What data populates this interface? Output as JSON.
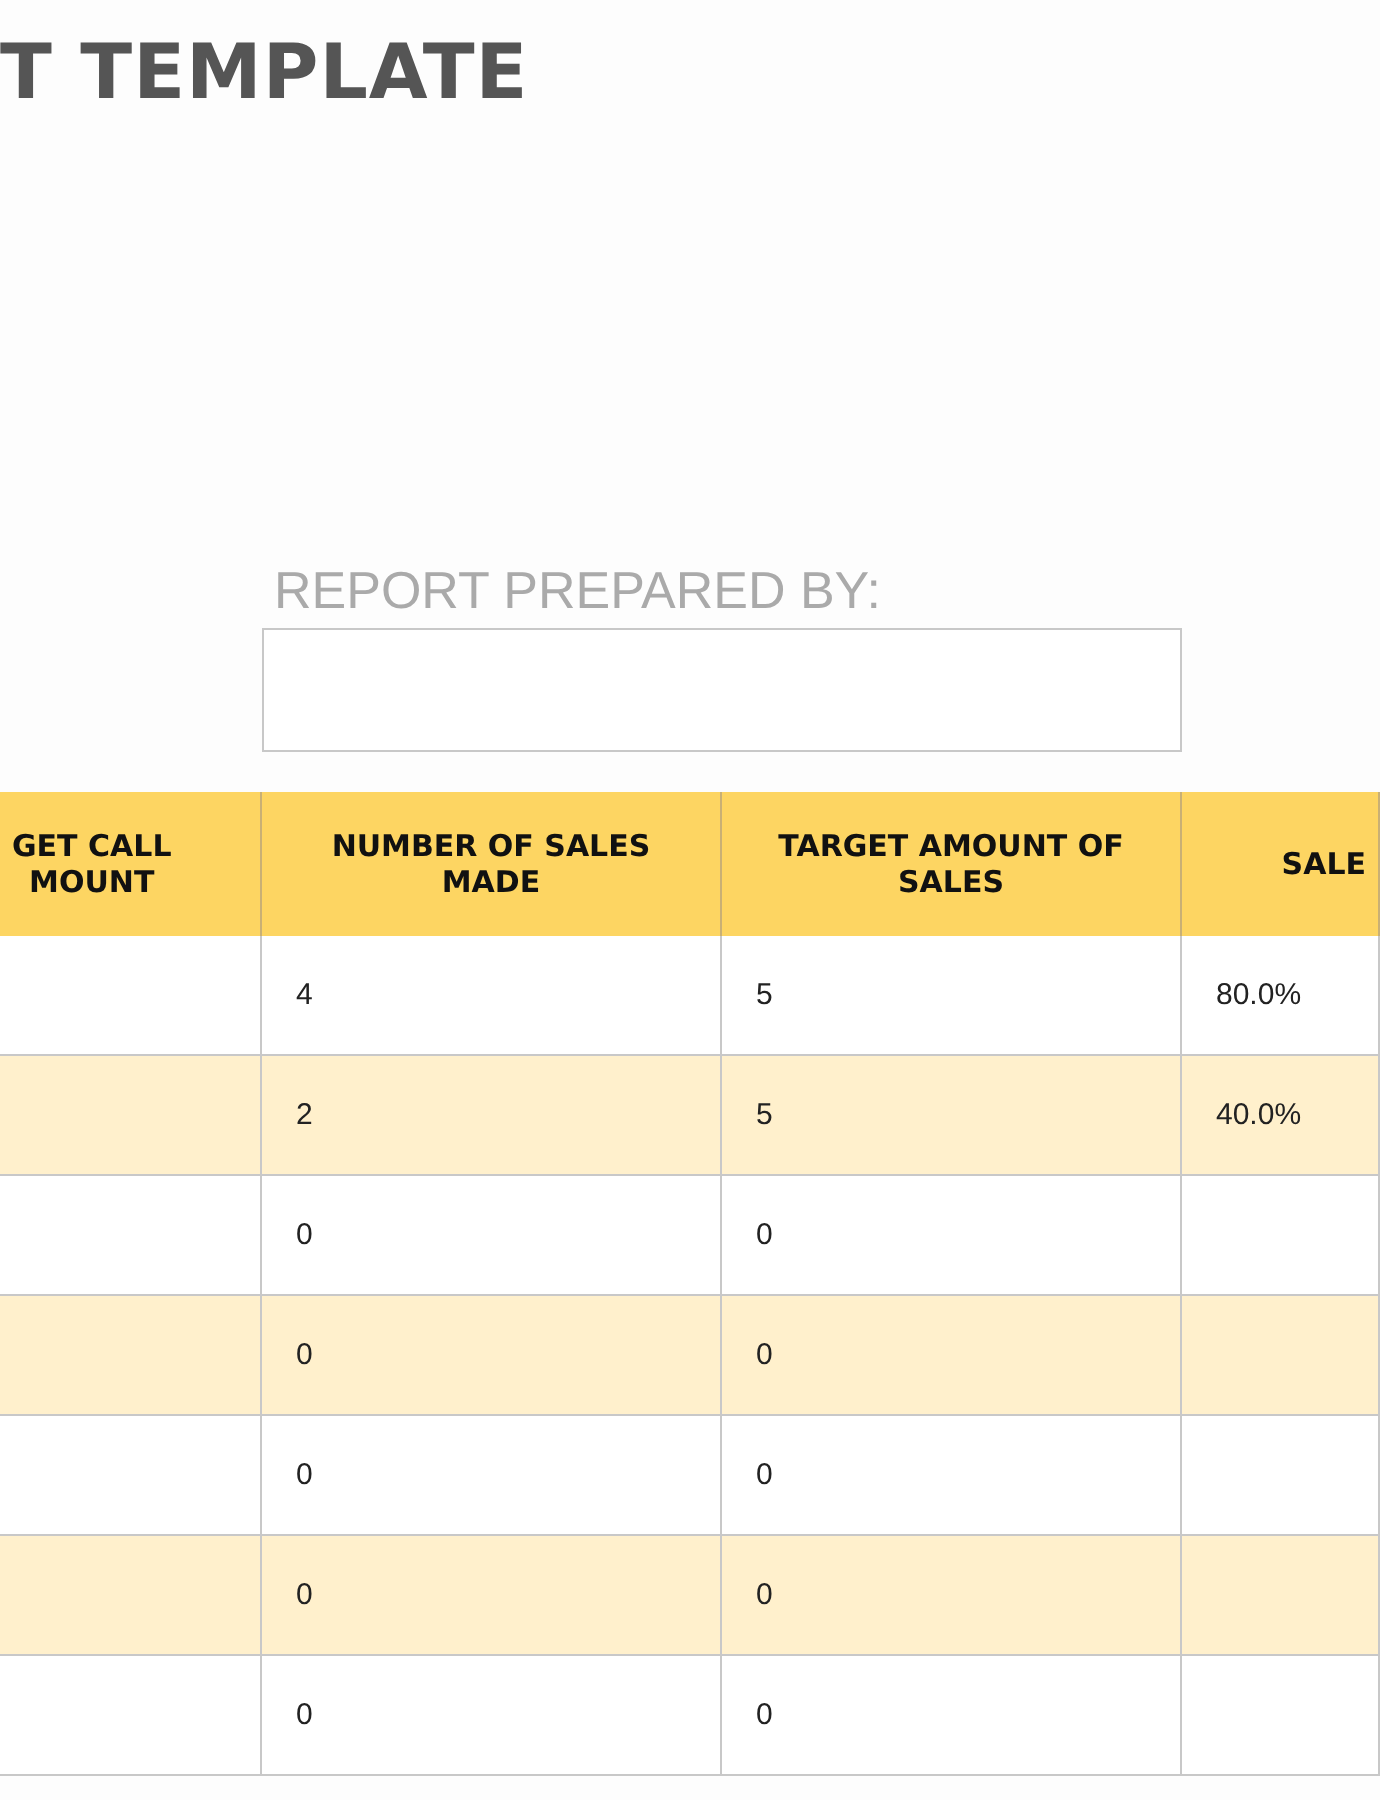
{
  "title": "T TEMPLATE",
  "prepared_by": {
    "label": "REPORT PREPARED BY:"
  },
  "table": {
    "columns": [
      "GET CALL\nMOUNT",
      "NUMBER OF SALES\nMADE",
      "TARGET AMOUNT OF\nSALES",
      "SALE"
    ],
    "rows": [
      [
        "",
        "4",
        "5",
        "80.0%"
      ],
      [
        "",
        "2",
        "5",
        "40.0%"
      ],
      [
        "",
        "0",
        "0",
        ""
      ],
      [
        "",
        "0",
        "0",
        ""
      ],
      [
        "",
        "0",
        "0",
        ""
      ],
      [
        "",
        "0",
        "0",
        ""
      ],
      [
        "",
        "0",
        "0",
        ""
      ]
    ]
  }
}
